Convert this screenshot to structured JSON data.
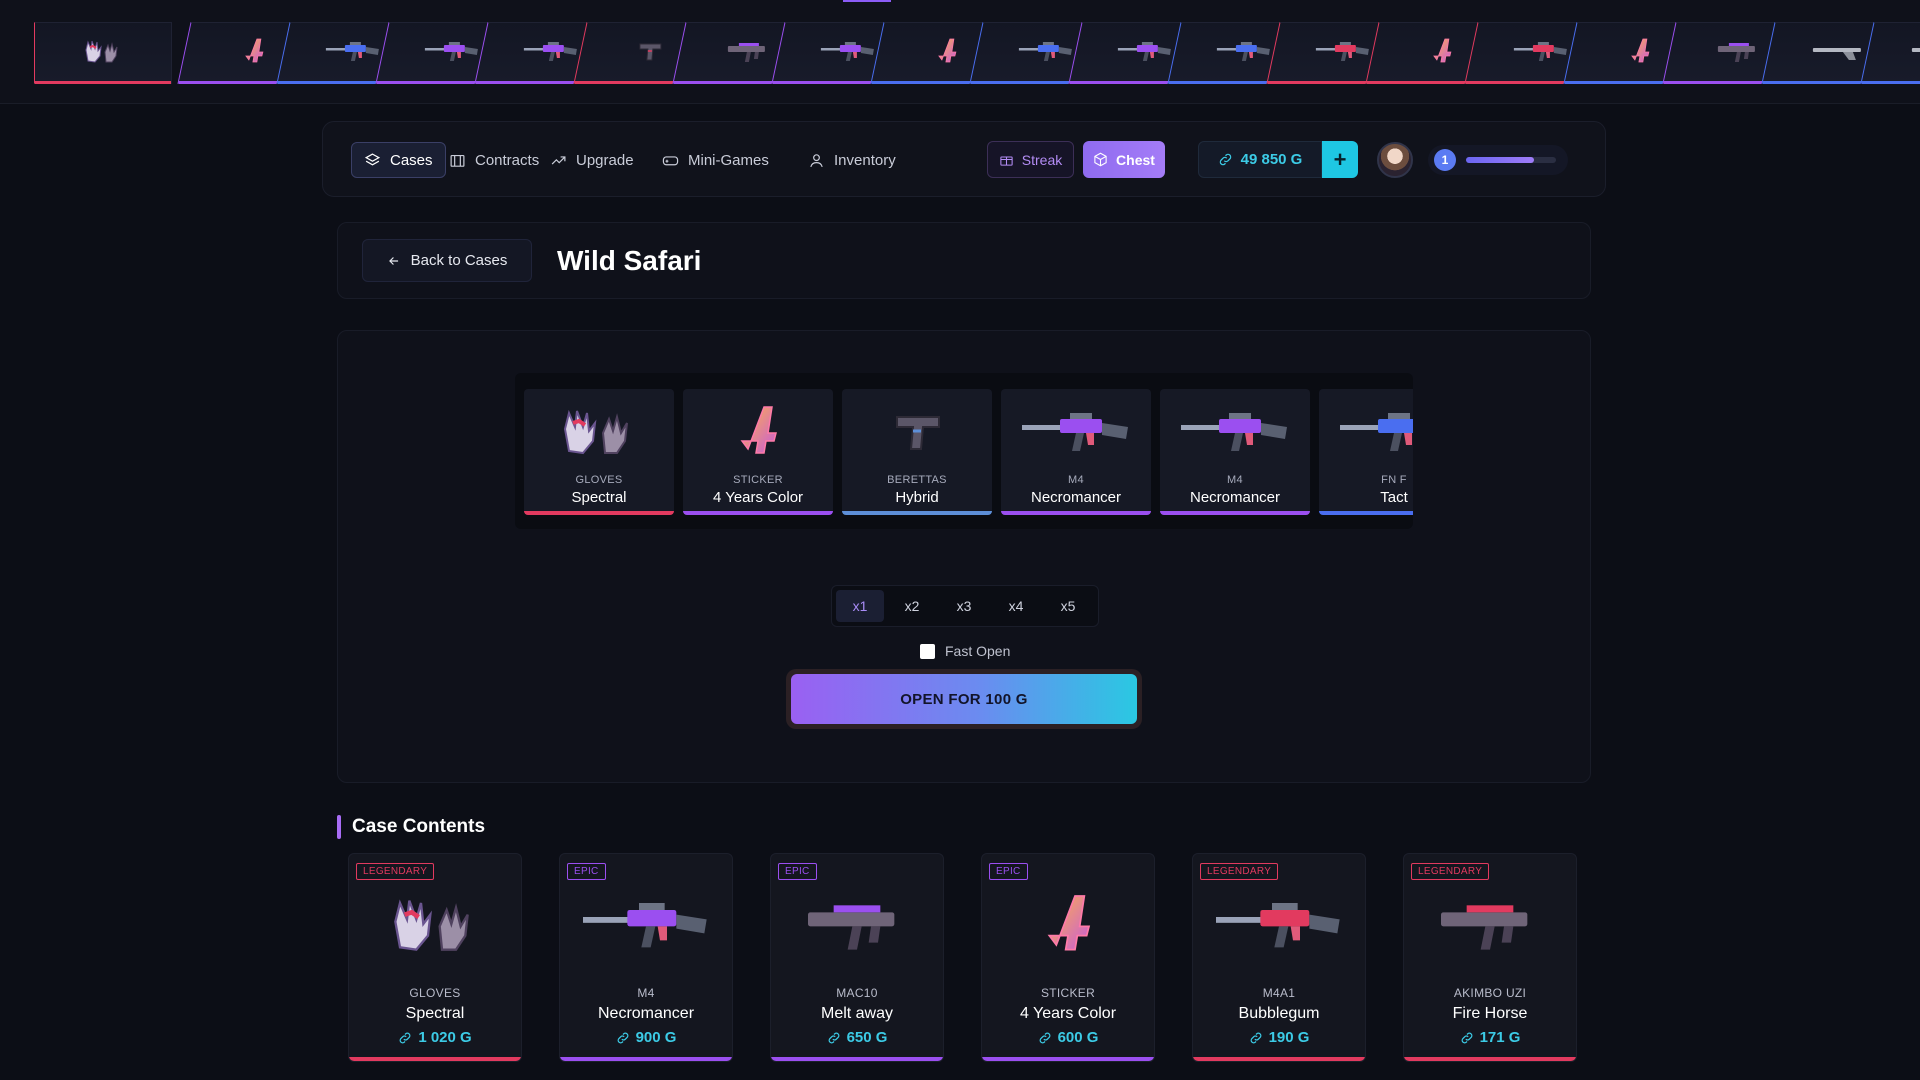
{
  "colors": {
    "legendary": "#e23a5f",
    "epic": "#9b4ff0",
    "rare": "#4a6ef0",
    "mythic": "#5d8fd8",
    "accent": "#a86cf5",
    "currency": "#3ccbe6"
  },
  "drops": [
    {
      "icon": "gloves-icon",
      "rarity": "legendary"
    },
    {
      "icon": "sticker-icon",
      "rarity": "epic"
    },
    {
      "icon": "rifle-icon",
      "rarity": "rare"
    },
    {
      "icon": "rifle-icon",
      "rarity": "epic"
    },
    {
      "icon": "rifle-icon",
      "rarity": "epic"
    },
    {
      "icon": "pistol-icon",
      "rarity": "legendary"
    },
    {
      "icon": "smg-icon",
      "rarity": "epic"
    },
    {
      "icon": "rifle-icon",
      "rarity": "epic"
    },
    {
      "icon": "sticker-icon",
      "rarity": "rare"
    },
    {
      "icon": "rifle-icon",
      "rarity": "rare"
    },
    {
      "icon": "rifle-icon",
      "rarity": "epic"
    },
    {
      "icon": "rifle-icon",
      "rarity": "rare"
    },
    {
      "icon": "rifle-icon",
      "rarity": "legendary"
    },
    {
      "icon": "sticker-icon",
      "rarity": "legendary"
    },
    {
      "icon": "rifle-icon",
      "rarity": "legendary"
    },
    {
      "icon": "sticker-icon",
      "rarity": "rare"
    },
    {
      "icon": "smg-icon",
      "rarity": "epic"
    },
    {
      "icon": "shotgun-icon",
      "rarity": "rare"
    },
    {
      "icon": "shotgun-icon",
      "rarity": "rare"
    }
  ],
  "nav": {
    "cases": "Cases",
    "contracts": "Contracts",
    "upgrade": "Upgrade",
    "mini_games": "Mini-Games",
    "inventory": "Inventory",
    "streak": "Streak",
    "chest": "Chest",
    "balance": "49 850 G",
    "add": "+",
    "level": "1",
    "level_progress": 0.75
  },
  "header": {
    "back": "Back to Cases",
    "title": "Wild Safari"
  },
  "reel": [
    {
      "type": "",
      "name": "",
      "rarity": "epic",
      "icon": "blank"
    },
    {
      "type": "GLOVES",
      "name": "Spectral",
      "rarity": "legendary",
      "icon": "gloves-icon"
    },
    {
      "type": "STICKER",
      "name": "4 Years Color",
      "rarity": "epic",
      "icon": "sticker-icon"
    },
    {
      "type": "BERETTAS",
      "name": "Hybrid",
      "rarity": "mythic",
      "icon": "pistol-icon"
    },
    {
      "type": "M4",
      "name": "Necromancer",
      "rarity": "epic",
      "icon": "rifle-icon"
    },
    {
      "type": "M4",
      "name": "Necromancer",
      "rarity": "epic",
      "icon": "rifle-icon"
    },
    {
      "type": "FN F",
      "name": "Tact",
      "rarity": "rare",
      "icon": "rifle-icon"
    }
  ],
  "opener": {
    "multipliers": [
      "x1",
      "x2",
      "x3",
      "x4",
      "x5"
    ],
    "active_multiplier": "x1",
    "fast_open": "Fast Open",
    "open_button": "OPEN FOR 100 G"
  },
  "contents": {
    "title": "Case Contents",
    "items": [
      {
        "badge": "LEGENDARY",
        "rarity": "legendary",
        "type": "GLOVES",
        "name": "Spectral",
        "price": "1 020 G",
        "icon": "gloves-icon"
      },
      {
        "badge": "EPIC",
        "rarity": "epic",
        "type": "M4",
        "name": "Necromancer",
        "price": "900 G",
        "icon": "rifle-icon"
      },
      {
        "badge": "EPIC",
        "rarity": "epic",
        "type": "MAC10",
        "name": "Melt away",
        "price": "650 G",
        "icon": "smg-icon"
      },
      {
        "badge": "EPIC",
        "rarity": "epic",
        "type": "STICKER",
        "name": "4 Years Color",
        "price": "600 G",
        "icon": "sticker-icon"
      },
      {
        "badge": "LEGENDARY",
        "rarity": "legendary",
        "type": "M4A1",
        "name": "Bubblegum",
        "price": "190 G",
        "icon": "rifle-icon"
      },
      {
        "badge": "LEGENDARY",
        "rarity": "legendary",
        "type": "AKIMBO UZI",
        "name": "Fire Horse",
        "price": "171 G",
        "icon": "smg-icon"
      }
    ]
  }
}
